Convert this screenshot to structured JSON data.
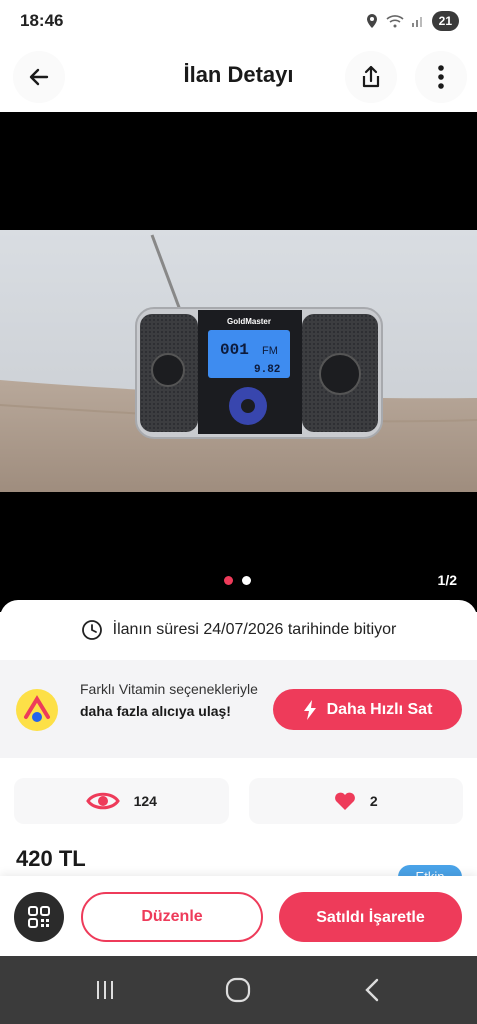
{
  "status_bar": {
    "time": "18:46",
    "battery": "21",
    "icons": [
      "location-icon",
      "wifi-icon",
      "signal-icon",
      "battery-icon"
    ]
  },
  "app_bar": {
    "title": "İlan Detayı",
    "icons": [
      "back-arrow-icon",
      "share-icon",
      "more-vertical-icon"
    ]
  },
  "photo": {
    "brand_text": "GoldMaster",
    "display_channel": "001",
    "display_band": "FM",
    "display_freq": "9.82",
    "counter": "1/2",
    "current_index": 1,
    "total": 2
  },
  "listing": {
    "expiry_text": "İlanın süresi 24/07/2026 tarihinde bitiyor",
    "price": "420 TL",
    "status_chip": "Etkin"
  },
  "promo": {
    "text_prefix": "Farklı Vitamin seçenekleriyle ",
    "text_bold": "daha fazla alıcıya ulaş!",
    "button_label": "Daha Hızlı Sat"
  },
  "stats": {
    "views": "124",
    "favorites": "2"
  },
  "actions": {
    "edit_label": "Düzenle",
    "sold_label": "Satıldı İşaretle"
  },
  "colors": {
    "accent": "#ee3b5a",
    "chip": "#4aa3e8",
    "nav_bg": "#3b3b3b"
  }
}
